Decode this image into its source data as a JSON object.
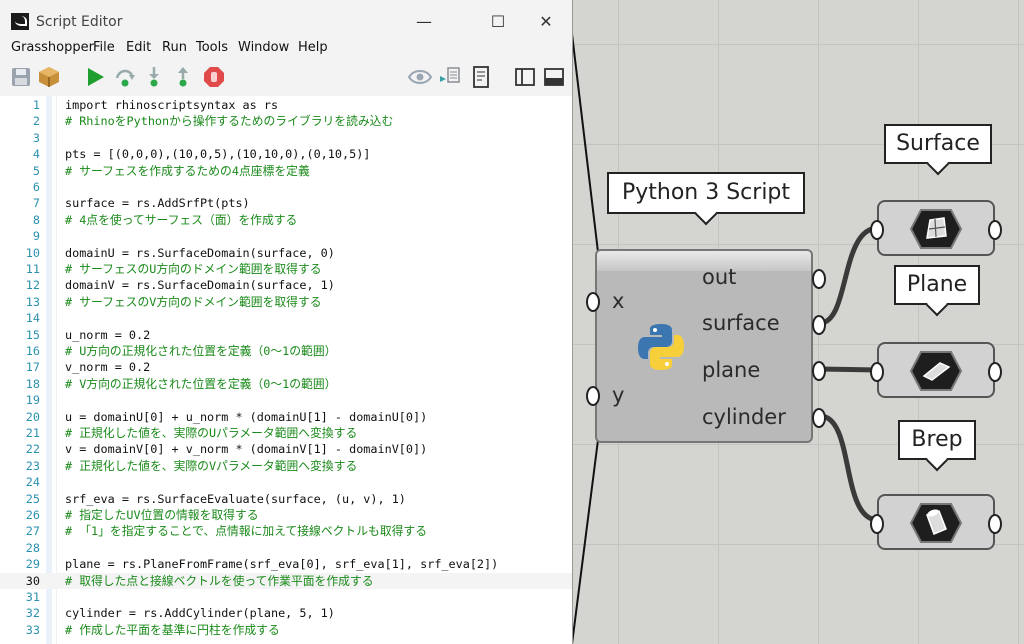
{
  "editor": {
    "title": "Script Editor",
    "window_buttons": {
      "minimize": "—",
      "maximize": "☐",
      "close": "✕"
    },
    "menu": [
      "Grasshopper",
      "File",
      "Edit",
      "Run",
      "Tools",
      "Window",
      "Help"
    ],
    "toolbar_icons": [
      "save-icon",
      "package-icon",
      "run-icon",
      "step-over-icon",
      "step-into-icon",
      "step-out-icon",
      "stop-icon",
      "preview-icon",
      "compare-icon",
      "console-icon",
      "split-vertical-icon",
      "split-horizontal-icon"
    ],
    "current_line": 30,
    "code_lines": [
      {
        "n": "1",
        "text": "import rhinoscriptsyntax as rs",
        "type": "code"
      },
      {
        "n": "2",
        "text": "# RhinoをPythonから操作するためのライブラリを読み込む",
        "type": "comment"
      },
      {
        "n": "3",
        "text": "",
        "type": "code"
      },
      {
        "n": "4",
        "text": "pts = [(0,0,0),(10,0,5),(10,10,0),(0,10,5)]",
        "type": "code"
      },
      {
        "n": "5",
        "text": "# サーフェスを作成するための4点座標を定義",
        "type": "comment"
      },
      {
        "n": "6",
        "text": "",
        "type": "code"
      },
      {
        "n": "7",
        "text": "surface = rs.AddSrfPt(pts)",
        "type": "code"
      },
      {
        "n": "8",
        "text": "# 4点を使ってサーフェス（面）を作成する",
        "type": "comment"
      },
      {
        "n": "9",
        "text": "",
        "type": "code"
      },
      {
        "n": "10",
        "text": "domainU = rs.SurfaceDomain(surface, 0)",
        "type": "code"
      },
      {
        "n": "11",
        "text": "# サーフェスのU方向のドメイン範囲を取得する",
        "type": "comment"
      },
      {
        "n": "12",
        "text": "domainV = rs.SurfaceDomain(surface, 1)",
        "type": "code"
      },
      {
        "n": "13",
        "text": "# サーフェスのV方向のドメイン範囲を取得する",
        "type": "comment"
      },
      {
        "n": "14",
        "text": "",
        "type": "code"
      },
      {
        "n": "15",
        "text": "u_norm = 0.2",
        "type": "code"
      },
      {
        "n": "16",
        "text": "# U方向の正規化された位置を定義（0〜1の範囲）",
        "type": "comment"
      },
      {
        "n": "17",
        "text": "v_norm = 0.2",
        "type": "code"
      },
      {
        "n": "18",
        "text": "# V方向の正規化された位置を定義（0〜1の範囲）",
        "type": "comment"
      },
      {
        "n": "19",
        "text": "",
        "type": "code"
      },
      {
        "n": "20",
        "text": "u = domainU[0] + u_norm * (domainU[1] - domainU[0])",
        "type": "code"
      },
      {
        "n": "21",
        "text": "# 正規化した値を、実際のUパラメータ範囲へ変換する",
        "type": "comment"
      },
      {
        "n": "22",
        "text": "v = domainV[0] + v_norm * (domainV[1] - domainV[0])",
        "type": "code"
      },
      {
        "n": "23",
        "text": "# 正規化した値を、実際のVパラメータ範囲へ変換する",
        "type": "comment"
      },
      {
        "n": "24",
        "text": "",
        "type": "code"
      },
      {
        "n": "25",
        "text": "srf_eva = rs.SurfaceEvaluate(surface, (u, v), 1)",
        "type": "code"
      },
      {
        "n": "26",
        "text": "# 指定したUV位置の情報を取得する",
        "type": "comment"
      },
      {
        "n": "27",
        "text": "# 「1」を指定することで、点情報に加えて接線ベクトルも取得する",
        "type": "comment"
      },
      {
        "n": "28",
        "text": "",
        "type": "code"
      },
      {
        "n": "29",
        "text": "plane = rs.PlaneFromFrame(srf_eva[0], srf_eva[1], srf_eva[2])",
        "type": "code"
      },
      {
        "n": "30",
        "text": "# 取得した点と接線ベクトルを使って作業平面を作成する",
        "type": "comment"
      },
      {
        "n": "31",
        "text": "",
        "type": "code"
      },
      {
        "n": "32",
        "text": "cylinder = rs.AddCylinder(plane, 5, 1)",
        "type": "code"
      },
      {
        "n": "33",
        "text": "# 作成した平面を基準に円柱を作成する",
        "type": "comment"
      }
    ]
  },
  "canvas": {
    "python_component": {
      "title": "Python 3 Script",
      "inputs": [
        "x",
        "y"
      ],
      "outputs": [
        "out",
        "surface",
        "plane",
        "cylinder"
      ],
      "icon": "python-logo-icon"
    },
    "params": [
      {
        "label": "Surface",
        "icon": "surface-param-icon"
      },
      {
        "label": "Plane",
        "icon": "plane-param-icon"
      },
      {
        "label": "Brep",
        "icon": "brep-param-icon"
      }
    ]
  }
}
